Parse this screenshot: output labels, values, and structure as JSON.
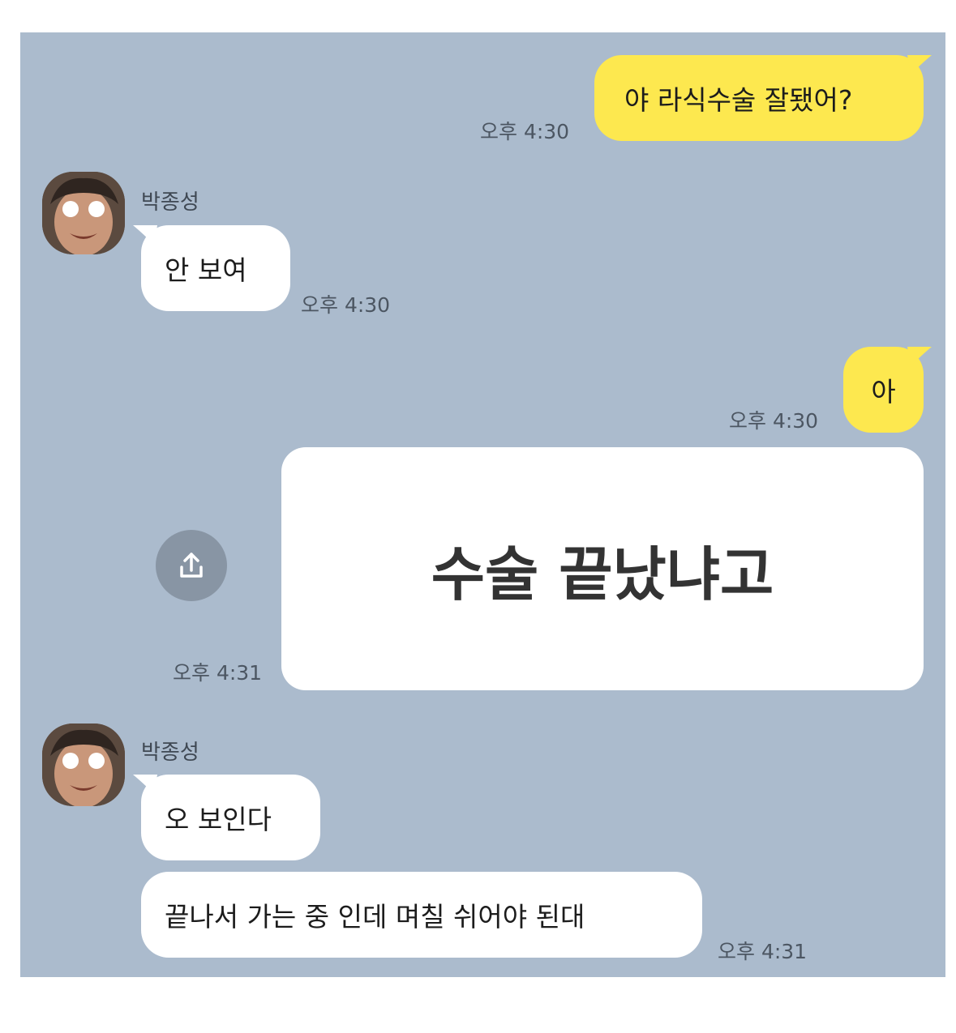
{
  "messages": {
    "m1": {
      "text": "야 라식수술 잘됐어?",
      "time": "오후 4:30"
    },
    "m2": {
      "sender": "박종성",
      "text": "안 보여",
      "time": "오후 4:30"
    },
    "m3": {
      "text": "아",
      "time": "오후 4:30"
    },
    "m4": {
      "text": "수술 끝났냐고",
      "time": "오후 4:31"
    },
    "m5": {
      "sender": "박종성",
      "text": "오 보인다"
    },
    "m6": {
      "text": "끝나서 가는 중 인데 며칠 쉬어야 된대",
      "time": "오후 4:31"
    }
  },
  "colors": {
    "chat_background": "#abbbcd",
    "my_bubble": "#fde84f",
    "their_bubble": "#ffffff",
    "share_button": "#8895a4"
  },
  "icons": {
    "share": "share-icon",
    "avatar": "avatar-image"
  }
}
